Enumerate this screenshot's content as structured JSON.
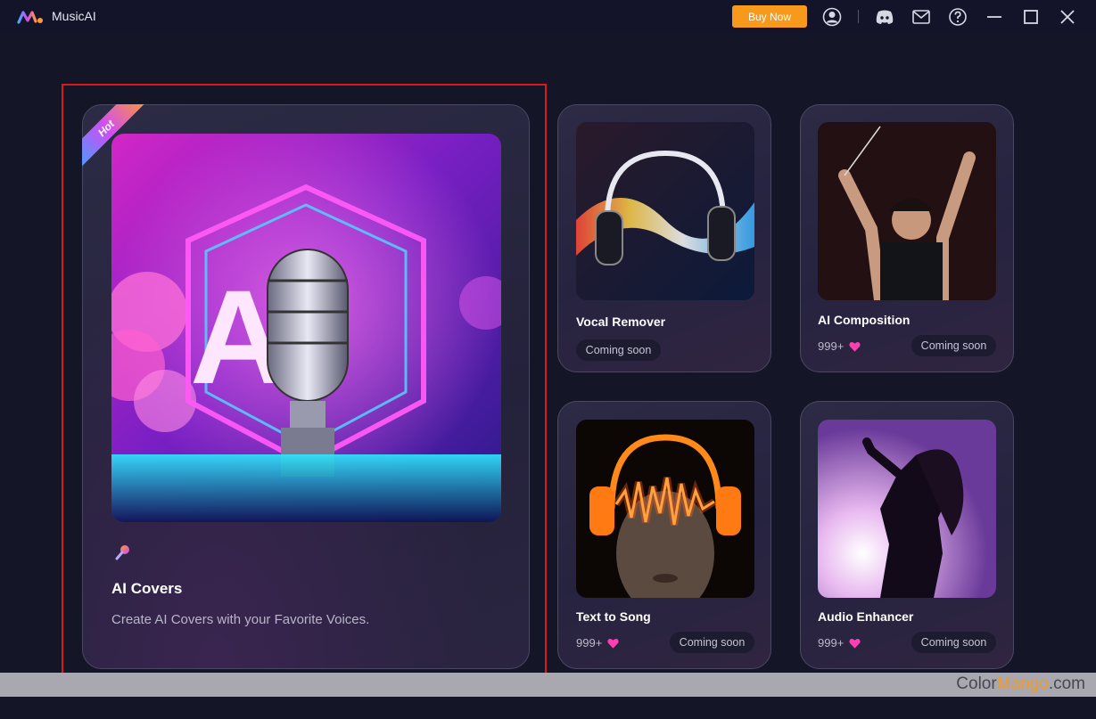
{
  "app": {
    "title": "MusicAI"
  },
  "header": {
    "buy_label": "Buy Now",
    "icons": [
      "account-icon",
      "discord-icon",
      "mail-icon",
      "help-icon",
      "minimize-icon",
      "maximize-icon",
      "close-icon"
    ]
  },
  "featured": {
    "badge": "Hot",
    "title": "AI Covers",
    "description": "Create AI Covers with your Favorite Voices.",
    "image_text": "AI"
  },
  "cards": [
    {
      "title": "Vocal Remover",
      "status": "Coming soon"
    },
    {
      "title": "AI Composition",
      "likes": "999+",
      "status": "Coming soon"
    },
    {
      "title": "Text to Song",
      "likes": "999+",
      "status": "Coming soon"
    },
    {
      "title": "Audio Enhancer",
      "likes": "999+",
      "status": "Coming soon"
    }
  ],
  "watermark": {
    "part1": "Color",
    "part2": "Mango",
    "part3": ".com"
  },
  "colors": {
    "accent": "#f79a1b",
    "heart": "#ff3fb0",
    "background": "#151528",
    "highlight": "#d9191c"
  }
}
